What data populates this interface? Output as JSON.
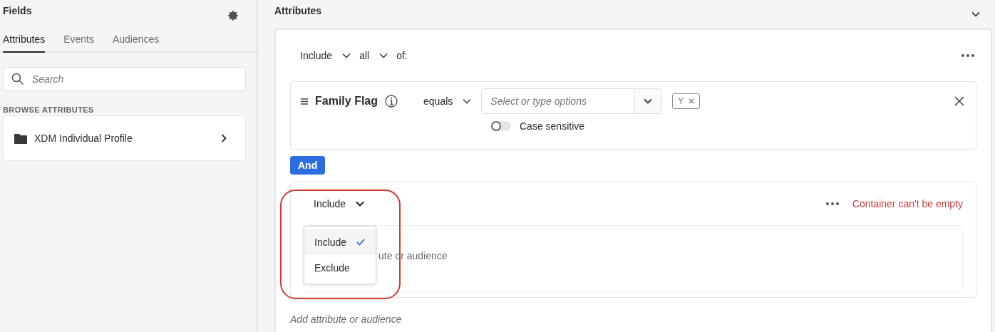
{
  "fields_panel": {
    "title": "Fields",
    "tabs": [
      {
        "label": "Attributes",
        "selected": true
      },
      {
        "label": "Events",
        "selected": false
      },
      {
        "label": "Audiences",
        "selected": false
      }
    ],
    "search": {
      "placeholder": "Search"
    },
    "section_label": "BROWSE ATTRIBUTES",
    "browse_items": [
      {
        "label": "XDM Individual Profile"
      }
    ]
  },
  "attributes_panel": {
    "title": "Attributes",
    "header": {
      "include": "Include",
      "quantifier": "all",
      "suffix": "of:"
    },
    "condition": {
      "name": "Family Flag",
      "operator": "equals",
      "value_placeholder": "Select or type options",
      "tags": [
        "Y"
      ],
      "case_sensitive": {
        "label": "Case sensitive",
        "on": false
      }
    },
    "and_button": "And",
    "container": {
      "include": "Include",
      "error": "Container can't be empty",
      "placeholder_visible": "ute or audience",
      "menu": [
        {
          "label": "Include",
          "selected": true
        },
        {
          "label": "Exclude",
          "selected": false
        }
      ],
      "highlighted": true
    },
    "add_placeholder": "Add attribute or audience"
  }
}
